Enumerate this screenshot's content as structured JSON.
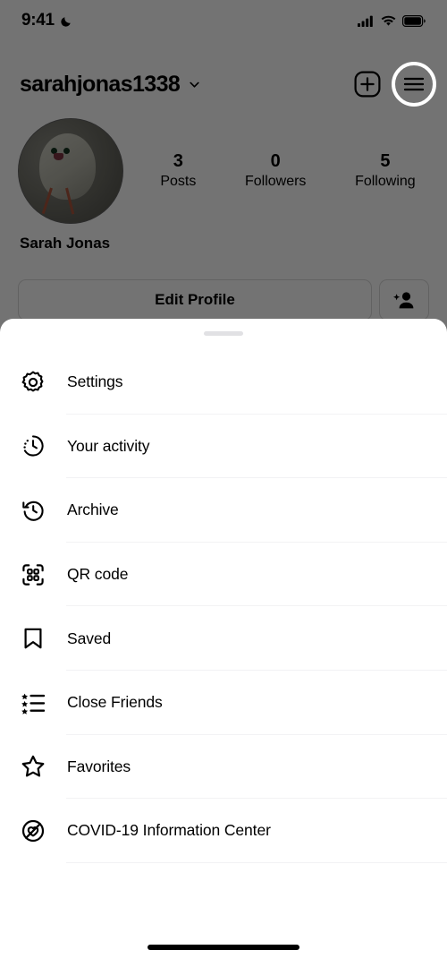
{
  "status_bar": {
    "time": "9:41",
    "moon_icon": "crescent-moon-icon",
    "signal_icon": "cellular-signal-icon",
    "wifi_icon": "wifi-icon",
    "battery_icon": "battery-icon"
  },
  "header": {
    "username": "sarahjonas1338",
    "chevron_icon": "chevron-down-icon",
    "add_icon": "plus-square-icon",
    "menu_icon": "hamburger-menu-icon"
  },
  "profile": {
    "full_name": "Sarah Jonas",
    "avatar_icon": "profile-avatar",
    "stats": [
      {
        "value": "3",
        "label": "Posts"
      },
      {
        "value": "0",
        "label": "Followers"
      },
      {
        "value": "5",
        "label": "Following"
      }
    ],
    "edit_profile_label": "Edit Profile",
    "add_person_icon": "add-person-icon"
  },
  "sheet": {
    "grabber": "drag-handle",
    "items": [
      {
        "label": "Settings",
        "icon": "gear-icon"
      },
      {
        "label": "Your activity",
        "icon": "activity-clock-icon"
      },
      {
        "label": "Archive",
        "icon": "archive-clock-icon"
      },
      {
        "label": "QR code",
        "icon": "qr-code-icon"
      },
      {
        "label": "Saved",
        "icon": "bookmark-icon"
      },
      {
        "label": "Close Friends",
        "icon": "star-list-icon"
      },
      {
        "label": "Favorites",
        "icon": "star-icon"
      },
      {
        "label": "COVID-19 Information Center",
        "icon": "covid-info-icon"
      }
    ]
  },
  "system": {
    "home_indicator": "home-indicator"
  },
  "colors": {
    "sheet_background": "#ffffff",
    "text_primary": "#000000",
    "divider": "#f2f2f4",
    "grabber": "#e1e1e4",
    "dim_overlay": "rgba(0,0,0,0.55)"
  }
}
